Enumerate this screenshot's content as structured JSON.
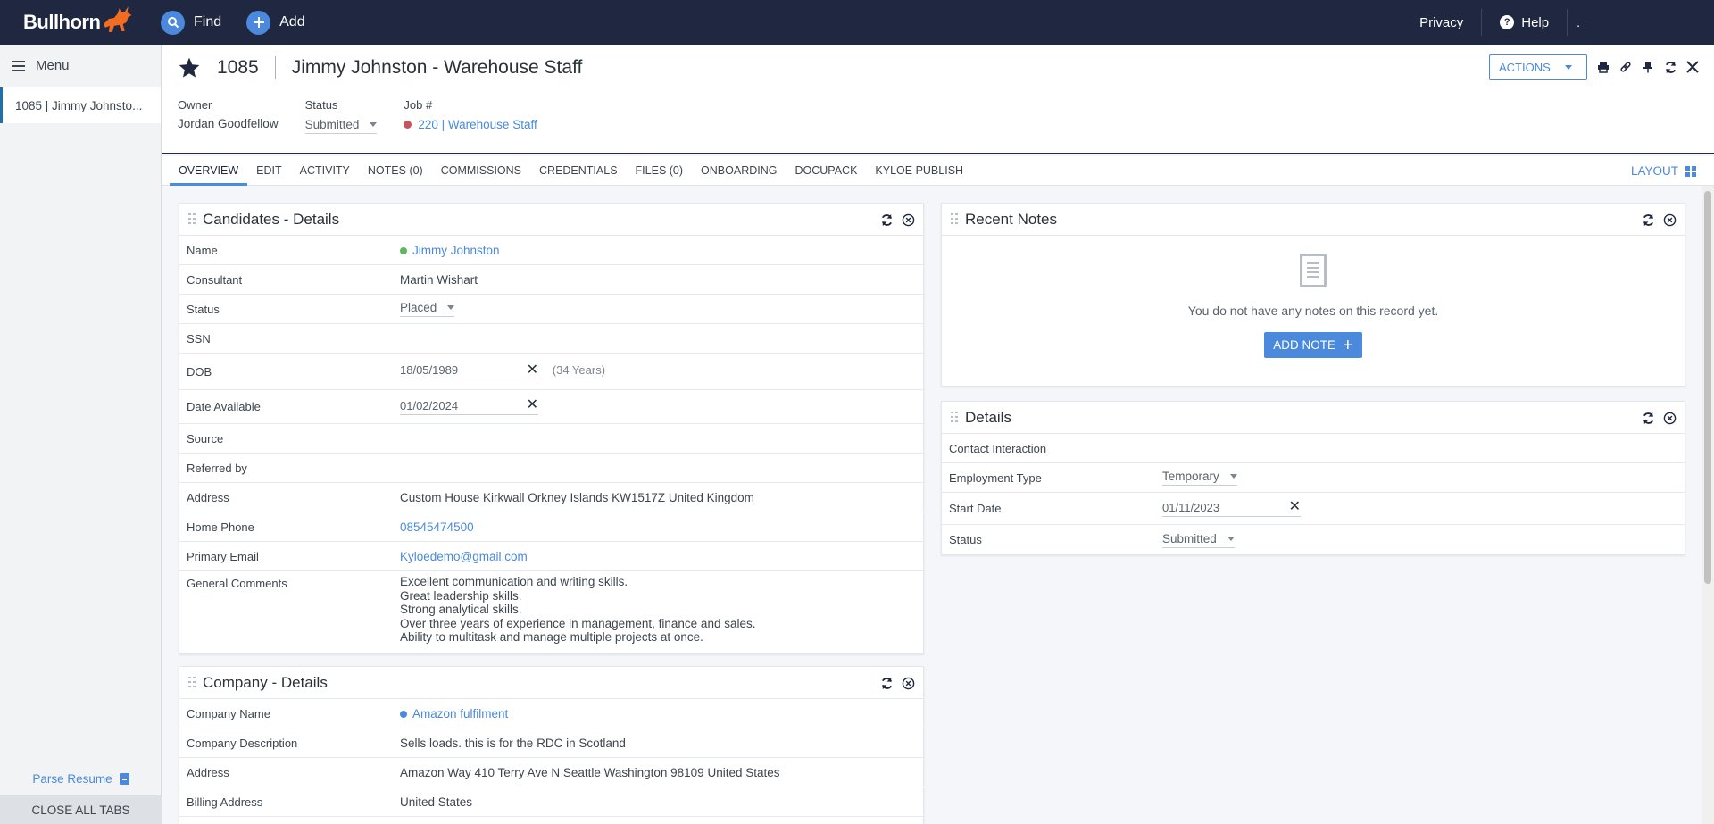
{
  "topnav": {
    "logo": "Bullhorn",
    "find_label": "Find",
    "add_label": "Add",
    "privacy_label": "Privacy",
    "help_label": "Help",
    "user_text": "."
  },
  "sidebar": {
    "menu_label": "Menu",
    "open_tab": "1085 | Jimmy Johnsto...",
    "parse_resume": "Parse Resume",
    "close_all_tabs": "CLOSE ALL TABS"
  },
  "record": {
    "id": "1085",
    "title": "Jimmy Johnston - Warehouse Staff",
    "owner_label": "Owner",
    "owner_value": "Jordan Goodfellow",
    "status_label": "Status",
    "status_value": "Submitted",
    "job_label": "Job #",
    "job_value": "220 | Warehouse Staff",
    "actions_label": "ACTIONS"
  },
  "tabs": [
    "OVERVIEW",
    "EDIT",
    "ACTIVITY",
    "NOTES (0)",
    "COMMISSIONS",
    "CREDENTIALS",
    "FILES (0)",
    "ONBOARDING",
    "DOCUPACK",
    "KYLOE PUBLISH"
  ],
  "layout_label": "LAYOUT",
  "candidate_card": {
    "title": "Candidates - Details",
    "name_label": "Name",
    "name_value": "Jimmy Johnston",
    "consultant_label": "Consultant",
    "consultant_value": "Martin Wishart",
    "status_label": "Status",
    "status_value": "Placed",
    "ssn_label": "SSN",
    "ssn_value": "",
    "dob_label": "DOB",
    "dob_value": "18/05/1989",
    "dob_years": "(34 Years)",
    "date_available_label": "Date Available",
    "date_available_value": "01/02/2024",
    "source_label": "Source",
    "source_value": "",
    "referred_label": "Referred by",
    "referred_value": "",
    "address_label": "Address",
    "address_value": "Custom House Kirkwall Orkney Islands KW1517Z United Kingdom",
    "phone_label": "Home Phone",
    "phone_value": "08545474500",
    "email_label": "Primary Email",
    "email_value": "Kyloedemo@gmail.com",
    "comments_label": "General Comments",
    "comments_lines": [
      "Excellent communication and writing skills.",
      "Great leadership skills.",
      "Strong analytical skills.",
      "Over three years of experience in management, finance and sales.",
      "Ability to multitask and manage multiple projects at once."
    ]
  },
  "company_card": {
    "title": "Company - Details",
    "name_label": "Company Name",
    "name_value": "Amazon fulfilment",
    "desc_label": "Company Description",
    "desc_value": "Sells loads. this is for the RDC in Scotland",
    "address_label": "Address",
    "address_value": "Amazon Way 410 Terry Ave N Seattle Washington 98109 United States",
    "billing_label": "Billing Address",
    "billing_value": "United States"
  },
  "notes_card": {
    "title": "Recent Notes",
    "empty_msg": "You do not have any notes on this record yet.",
    "add_note": "ADD NOTE"
  },
  "details_card": {
    "title": "Details",
    "contact_label": "Contact Interaction",
    "contact_value": "",
    "employment_label": "Employment Type",
    "employment_value": "Temporary",
    "start_label": "Start Date",
    "start_value": "01/11/2023",
    "status_label": "Status",
    "status_value": "Submitted"
  },
  "colors": {
    "nav_bg": "#1f2840",
    "accent": "#4a89dc",
    "logo_orange": "#f26c22",
    "green_status": "#5cb85c",
    "red_status": "#c6535e"
  }
}
